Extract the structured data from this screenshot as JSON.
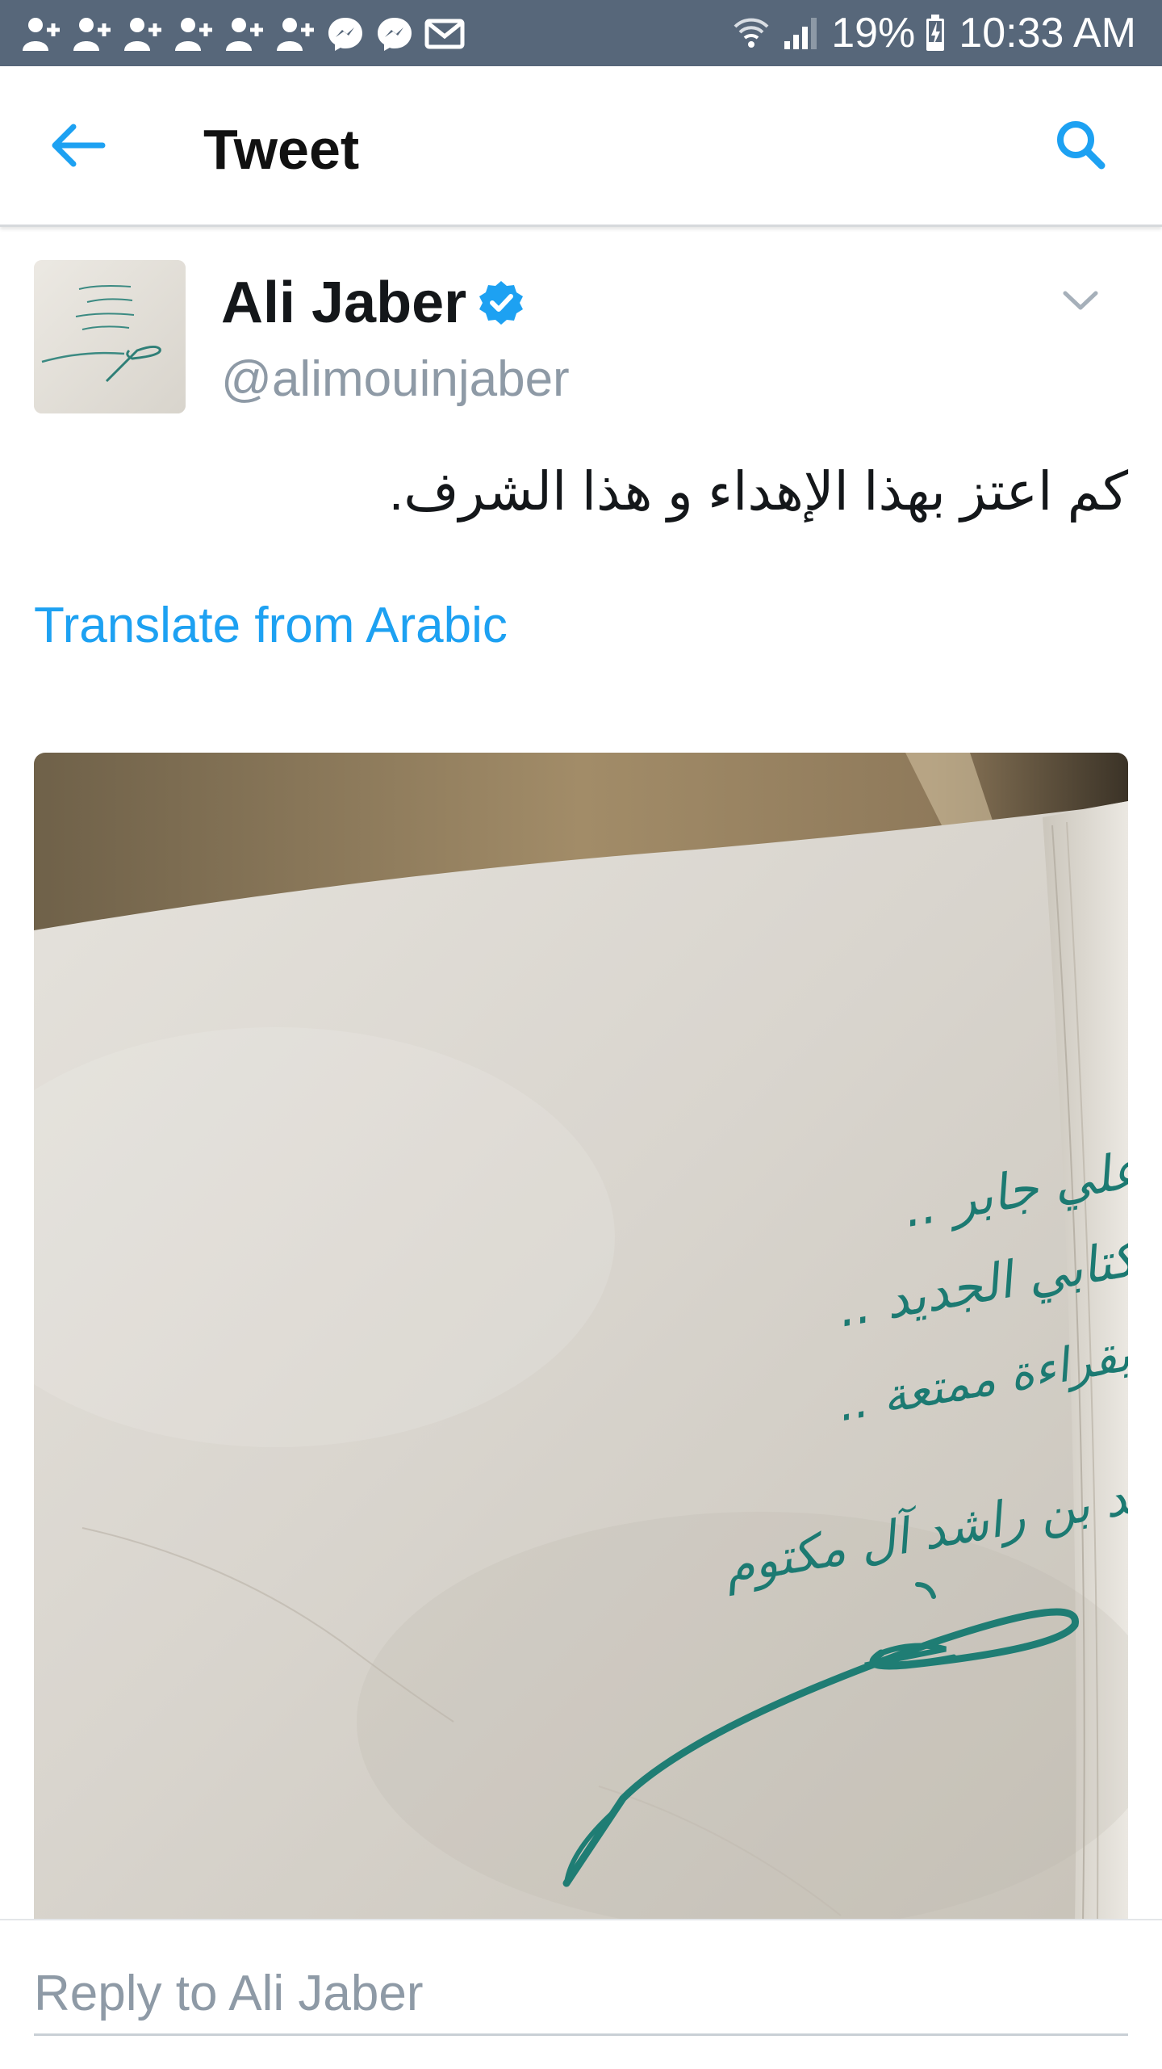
{
  "status_bar": {
    "notification_icons": [
      "add-user-icon",
      "add-user-icon",
      "add-user-icon",
      "add-user-icon",
      "add-user-icon",
      "add-user-icon",
      "messenger-icon",
      "messenger-icon",
      "mail-icon"
    ],
    "battery_percent": "19%",
    "time": "10:33 AM"
  },
  "toolbar": {
    "title": "Tweet"
  },
  "tweet": {
    "display_name": "Ali Jaber",
    "handle": "@alimouinjaber",
    "text": "كم اعتز بهذا الإهداء و هذا الشرف.",
    "translate_label": "Translate from Arabic",
    "media_inscription": [
      "إلى الأخ علي جابر ..",
      "أهديك كتابي الجديد ..",
      "مع تمنياتي بقراءة ممتعة ..",
      "أخوك محمد بن راشد آل مكتوم"
    ]
  },
  "reply": {
    "placeholder": "Reply to Ali Jaber"
  },
  "colors": {
    "status_bar": "#57677a",
    "accent": "#1da1f2",
    "verified": "#1da1f2",
    "handle_gray": "#8e9aa6",
    "ink": "#1c7a72"
  }
}
